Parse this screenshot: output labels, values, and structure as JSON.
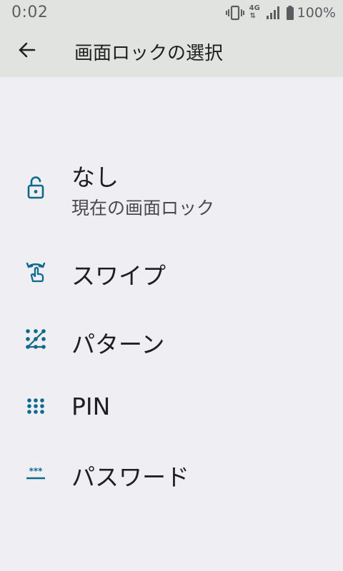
{
  "status_bar": {
    "time": "0:02",
    "network_type": "4G",
    "battery_percent": "100%",
    "icons": [
      "vibrate-icon",
      "network-4g-icon",
      "signal-icon",
      "battery-icon"
    ]
  },
  "app_bar": {
    "title": "画面ロックの選択",
    "back_icon": "back-arrow-icon"
  },
  "options": [
    {
      "label": "なし",
      "summary": "現在の画面ロック",
      "icon": "unlock-icon"
    },
    {
      "label": "スワイプ",
      "icon": "swipe-icon"
    },
    {
      "label": "パターン",
      "icon": "pattern-icon"
    },
    {
      "label": "PIN",
      "icon": "pin-icon"
    },
    {
      "label": "パスワード",
      "icon": "password-icon"
    }
  ],
  "colors": {
    "accent": "#0e6a8a",
    "header_bg": "#e1e3e1",
    "page_bg": "#eeeef3",
    "primary_text": "#1f1f1f",
    "secondary_text": "#4a4a4d"
  }
}
